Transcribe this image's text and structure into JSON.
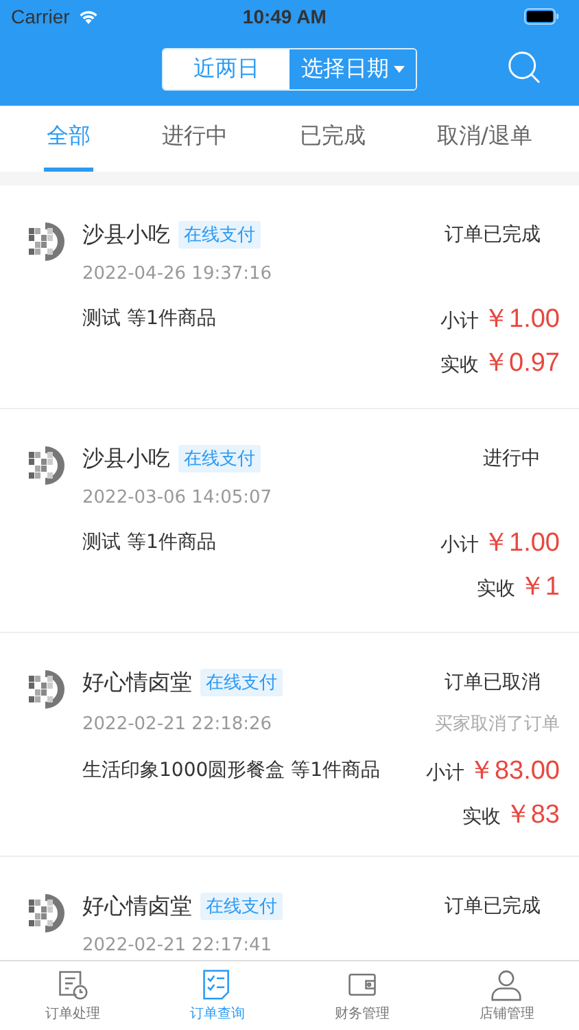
{
  "status_bar": {
    "carrier": "Carrier",
    "time": "10:49 AM"
  },
  "date_filter": [
    {
      "label": "近两日",
      "selected": true,
      "dropdown": false
    },
    {
      "label": "选择日期",
      "selected": false,
      "dropdown": true
    }
  ],
  "tabs": [
    {
      "label": "全部",
      "selected": true
    },
    {
      "label": "进行中",
      "selected": false
    },
    {
      "label": "已完成",
      "selected": false
    },
    {
      "label": "取消/退单",
      "selected": false
    }
  ],
  "orders": [
    {
      "store": "沙县小吃",
      "payment": "在线支付",
      "status": "订单已完成",
      "time": "2022-04-26 19:37:16",
      "items": "测试 等1件商品",
      "subtotal_label": "小计",
      "subtotal": "￥1.00",
      "paid_label": "实收",
      "paid": "￥0.97"
    },
    {
      "store": "沙县小吃",
      "payment": "在线支付",
      "status": "进行中",
      "time": "2022-03-06 14:05:07",
      "items": "测试 等1件商品",
      "subtotal_label": "小计",
      "subtotal": "￥1.00",
      "paid_label": "实收",
      "paid": "￥1"
    },
    {
      "store": "好心情卤堂",
      "payment": "在线支付",
      "status": "订单已取消",
      "note": "买家取消了订单",
      "time": "2022-02-21 22:18:26",
      "items": "生活印象1000圆形餐盒 等1件商品",
      "subtotal_label": "小计",
      "subtotal": "￥83.00",
      "paid_label": "实收",
      "paid": "￥83"
    },
    {
      "store": "好心情卤堂",
      "payment": "在线支付",
      "status": "订单已完成",
      "time": "2022-02-21 22:17:41"
    }
  ],
  "bottom_nav": [
    {
      "label": "订单处理",
      "selected": false
    },
    {
      "label": "订单查询",
      "selected": true
    },
    {
      "label": "财务管理",
      "selected": false
    },
    {
      "label": "店铺管理",
      "selected": false
    }
  ]
}
